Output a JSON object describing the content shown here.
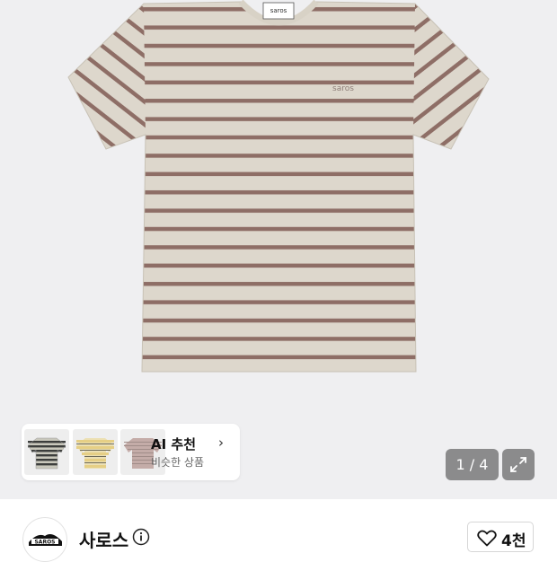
{
  "product": {
    "brand_print": "saros",
    "tag_text": "saros"
  },
  "ai_recommend": {
    "title": "AI 추천",
    "subtitle": "비슷한 상품",
    "chevron": "›",
    "thumbnails": [
      {
        "name": "thumb-gray-stripe",
        "colors": [
          "#3c3e3c",
          "#c9c8bc"
        ]
      },
      {
        "name": "thumb-yellow-stripe",
        "colors": [
          "#e6cf85",
          "#6e6a58"
        ]
      },
      {
        "name": "thumb-pink-stripe",
        "colors": [
          "#c4aca8",
          "#a08c88"
        ]
      }
    ]
  },
  "gallery": {
    "pager": "1 / 4"
  },
  "shop": {
    "name": "사로스",
    "likes": "4천",
    "logo_text": "SAROS"
  },
  "colors": {
    "shirt_base": "#ddd7cc",
    "stripe": "#8e6e66",
    "accent_dark": "#111111"
  }
}
